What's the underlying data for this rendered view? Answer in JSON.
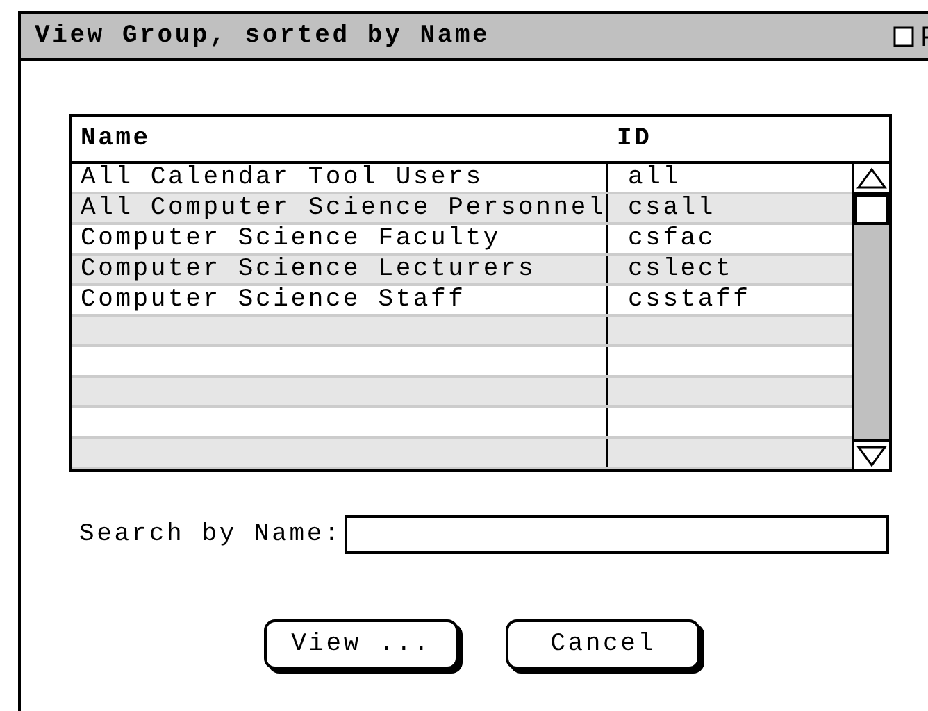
{
  "window": {
    "title": "View Group, sorted by Name"
  },
  "table": {
    "columns": [
      "Name",
      "ID"
    ],
    "rows": [
      {
        "name": "All Calendar Tool Users",
        "id": "all"
      },
      {
        "name": "All Computer Science Personnel",
        "id": "csall"
      },
      {
        "name": "Computer Science Faculty",
        "id": "csfac"
      },
      {
        "name": "Computer Science Lecturers",
        "id": "cslect"
      },
      {
        "name": "Computer Science Staff",
        "id": "csstaff"
      }
    ]
  },
  "search": {
    "label": "Search by Name:"
  },
  "buttons": [
    "View ...",
    "Cancel"
  ]
}
